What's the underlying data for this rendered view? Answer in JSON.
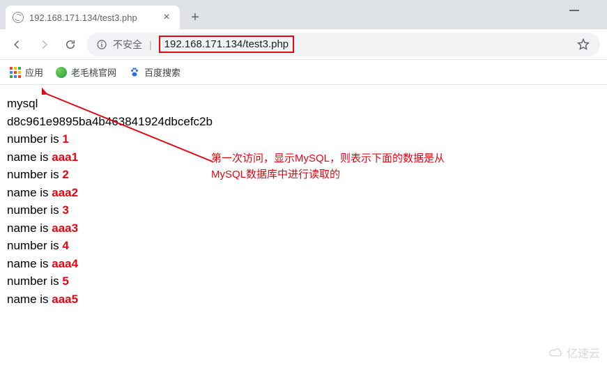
{
  "tab": {
    "title": "192.168.171.134/test3.php"
  },
  "omnibox": {
    "unsafe_label": "不安全",
    "url": "192.168.171.134/test3.php"
  },
  "bookmarks": {
    "apps": "应用",
    "laomaotao": "老毛桃官网",
    "baidu": "百度搜索"
  },
  "content": {
    "source": "mysql",
    "hash": "d8c961e9895ba4b463841924dbcefc2b",
    "number_label": "number is ",
    "name_label": "name is ",
    "rows": [
      {
        "number": "1",
        "name": "aaa1"
      },
      {
        "number": "2",
        "name": "aaa2"
      },
      {
        "number": "3",
        "name": "aaa3"
      },
      {
        "number": "4",
        "name": "aaa4"
      },
      {
        "number": "5",
        "name": "aaa5"
      }
    ]
  },
  "annotation": {
    "line1": "第一次访问，显示MySQL，则表示下面的数据是从",
    "line2": "MySQL数据库中进行读取的"
  },
  "watermark": "亿速云"
}
